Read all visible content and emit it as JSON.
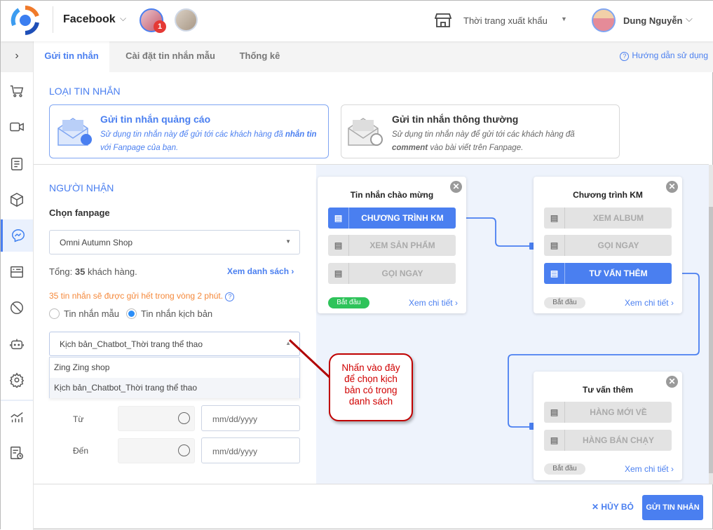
{
  "header": {
    "channel": "Facebook",
    "page_badge": "1",
    "store_name": "Thời trang xuất khẩu",
    "user_name": "Dung Nguyễn"
  },
  "tabs": [
    {
      "label": "Gửi tin nhắn",
      "active": true
    },
    {
      "label": "Cài đặt tin nhắn mẫu"
    },
    {
      "label": "Thống kê"
    }
  ],
  "help_link": "Hướng dẫn sử dụng",
  "message_type": {
    "heading": "LOẠI TIN NHẮN",
    "ad": {
      "title": "Gửi tin nhắn quảng cáo",
      "desc1": "Sử dụng tin nhắn này để gửi tới các khách hàng đã ",
      "desc_bold": "nhắn tin",
      "desc2": "với Fanpage của bạn."
    },
    "normal": {
      "title": "Gửi tin nhắn thông thường",
      "desc1": "Sử dụng tin nhắn này để gửi tới các khách hàng đã",
      "desc_bold": "comment",
      "desc2": " vào bài viết trên Fanpage."
    }
  },
  "recipient": {
    "heading": "NGƯỜI NHẬN",
    "fanpage_label": "Chọn fanpage",
    "fanpage_value": "Omni Autumn Shop",
    "total_prefix": "Tổng: ",
    "total_count": "35",
    "total_suffix": " khách hàng.",
    "view_list": "Xem danh sách",
    "notice": "35 tin nhắn sẽ được gửi hết trong vòng 2 phút.",
    "radio_template": "Tin nhắn mẫu",
    "radio_script": "Tin nhắn kịch bản",
    "script_value": "Kịch bản_Chatbot_Thời trang thể thao",
    "options": [
      "Zing Zing shop",
      "Kịch bản_Chatbot_Thời trang thể thao"
    ],
    "from_label": "Từ",
    "to_label": "Đến",
    "date_placeholder": "mm/dd/yyyy"
  },
  "callout": "Nhấn vào đây để chọn kịch bản có trong danh sách",
  "flow": {
    "nodes": [
      {
        "title": "Tin nhắn chào mừng",
        "buttons": [
          "CHƯƠNG TRÌNH KM",
          "XEM SẢN PHẨM",
          "GỌI NGAY"
        ],
        "start": "Bắt đầu",
        "detail": "Xem chi tiết"
      },
      {
        "title": "Chương trình KM",
        "buttons": [
          "XEM ALBUM",
          "GỌI NGAY",
          "TƯ VẤN THÊM"
        ],
        "start": "Bắt đầu",
        "detail": "Xem chi tiết"
      },
      {
        "title": "Tư vấn thêm",
        "buttons": [
          "HÀNG MỚI VỀ",
          "HÀNG BÁN CHẠY"
        ],
        "start": "Bắt đầu",
        "detail": "Xem chi tiết"
      }
    ]
  },
  "footer": {
    "cancel": "HỦY BỎ",
    "send": "GỬI TIN NHẮN"
  },
  "colors": {
    "accent": "#4a7ff0",
    "warning": "#f5893b",
    "success": "#2ec35a",
    "callout": "#c00000"
  }
}
